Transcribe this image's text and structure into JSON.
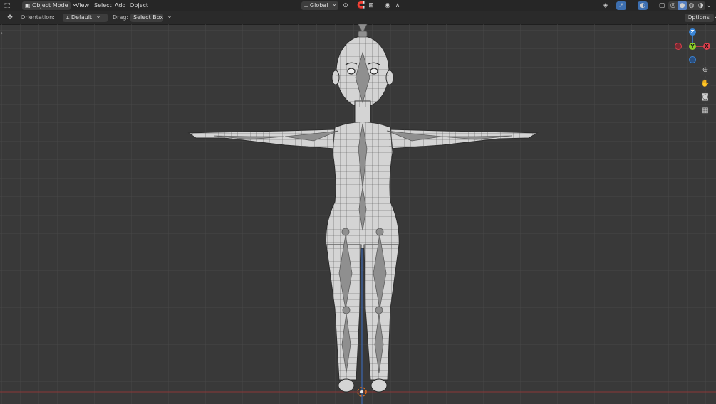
{
  "header": {
    "editor_type_icon": "3d-viewport-icon",
    "mode": "Object Mode",
    "menus": [
      "View",
      "Select",
      "Add",
      "Object"
    ],
    "transform_orientation": "Global",
    "pivot_icon": "pivot-icon",
    "snap_icon": "snap-icon",
    "proportional_icon": "proportional-editing-icon",
    "visibility_icon": "visibility-icon",
    "gizmo_icon": "gizmo-icon",
    "overlay_icon": "overlay-icon",
    "xray_icon": "xray-icon",
    "shading_modes": [
      "wireframe",
      "solid",
      "material",
      "rendered"
    ]
  },
  "tool_settings": {
    "tool_icon": "transform-icon",
    "orientation_label": "Orientation:",
    "orientation_value": "Default",
    "drag_label": "Drag:",
    "drag_value": "Select Box",
    "options_label": "Options"
  },
  "navigation_gizmo": {
    "z": "Z",
    "y": "Y",
    "x": "X",
    "colors": {
      "x": "#e1404d",
      "y": "#8bd029",
      "z": "#3a86d8"
    }
  },
  "nav_buttons": [
    "zoom-icon",
    "hand-pan-icon",
    "camera-icon",
    "grid-ortho-icon"
  ],
  "colors": {
    "grid_bg": "#393939",
    "grid_line": "#444444",
    "x_axis": "#9b3b3b",
    "z_axis": "#3a6ec7",
    "mesh": "#d2d2d2",
    "bone": "#8a8a8a"
  }
}
